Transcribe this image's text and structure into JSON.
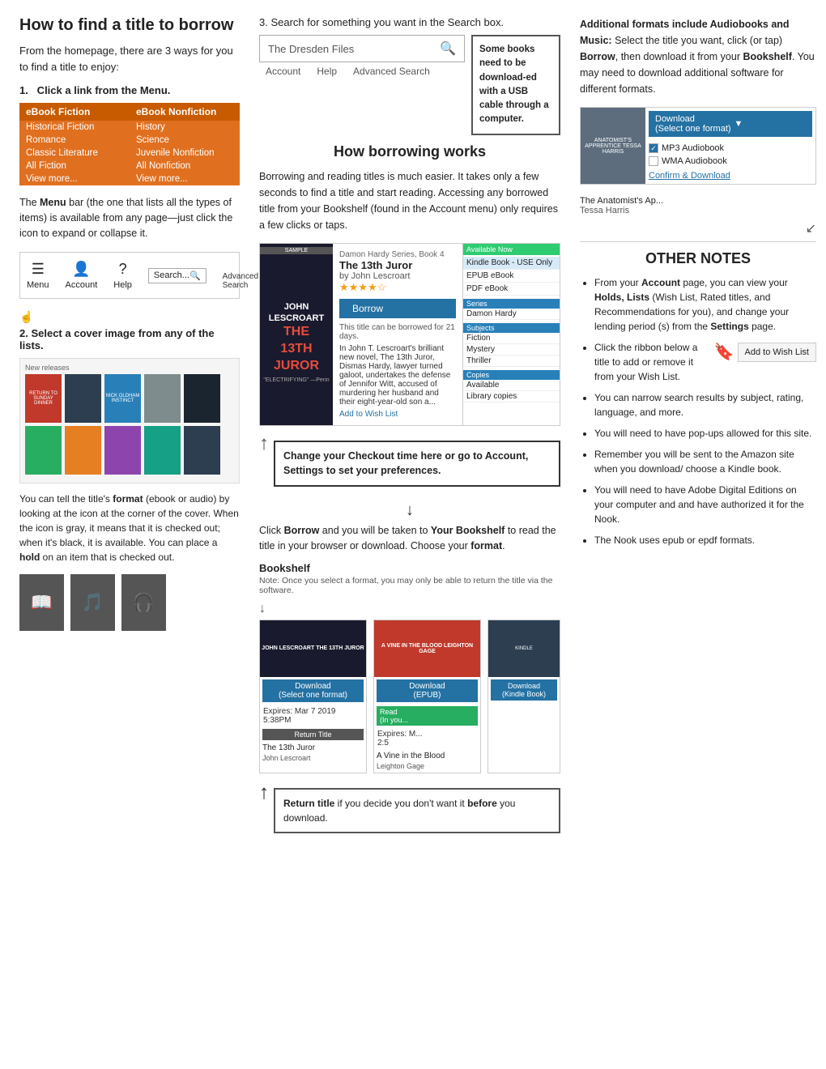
{
  "page": {
    "title": "How to find a title to borrow"
  },
  "left": {
    "title": "How to find a title to borrow",
    "intro": "From the homepage, there are 3 ways for you to find a title to enjoy:",
    "step1": {
      "label": "1.  Click a link from the ",
      "bold": "Menu.",
      "menu": {
        "col1_header": "eBook Fiction",
        "col1_items": [
          "Historical Fiction",
          "Romance",
          "Classic Literature",
          "All Fiction",
          "View more..."
        ],
        "col2_header": "eBook Nonfiction",
        "col2_items": [
          "History",
          "Science",
          "Juvenile Nonfiction",
          "All Nonfiction",
          "View more..."
        ]
      },
      "desc": "The Menu bar (the one that lists all the types of items) is available from any page—just click the icon to expand or collapse it.",
      "nav_items": [
        "Menu",
        "Account",
        "Help"
      ],
      "nav_search_placeholder": "Search..."
    },
    "step2": {
      "label": "2. Select a cover image from any of the lists.",
      "desc1": "You can tell the title's ",
      "bold1": "format",
      "desc2": " (ebook or audio) by looking at the icon at the corner of the cover. When the icon is gray, it means that it is checked out; when it's black, it is available. You can place a ",
      "bold2": "hold",
      "desc3": " on an item that is checked out."
    }
  },
  "middle": {
    "step3": "3.   Search for something you want in the Search box.",
    "search_value": "The Dresden Files",
    "search_links": [
      "Account",
      "Help",
      "Advanced Search"
    ],
    "how_borrow_title": "How borrowing works",
    "borrow_desc": "Borrowing and reading titles is much easier. It takes only a few seconds to find a title and start reading. Accessing any borrowed title from your Bookshelf (found in the Account menu) only requires a few clicks or taps.",
    "book_detail": {
      "series": "Damon Hardy Series, Book 4",
      "title": "The 13th Juror",
      "author": "by John Lescroart",
      "borrow_btn": "Borrow",
      "note": "This title can be borrowed for 21 days.",
      "sample_badge": "SAMPLE",
      "available_label": "Available Now",
      "formats": [
        "Kindle Book - USE Only",
        "EPUB eBook",
        "PDF eBook"
      ],
      "sidebar_sections": {
        "series_label": "Series",
        "series_val": "Damon Hardy",
        "subjects_label": "Subjects",
        "subjects": [
          "Fiction",
          "Mystery",
          "Thriller"
        ],
        "copies_label": "Copies",
        "copies": [
          "Available",
          "Library copies"
        ]
      }
    },
    "checkout_callout": "Change your Checkout time here or go to Account, Settings to set your preferences.",
    "click_borrow": {
      "text1": "Click ",
      "bold1": "Borrow",
      "text2": " and you will be taken to ",
      "bold2": "Your Bookshelf",
      "text3": " to read the title in your browser or download. Choose your ",
      "bold3": "format",
      "text4": "."
    },
    "bookshelf_title": "Bookshelf",
    "bookshelf_note": "Note: Once you select a format, you may only be able to return the title via the software.",
    "bs_card1": {
      "title": "The 13th Juror",
      "author": "John Lescroart",
      "download_btn": "Download\n(Select one format)",
      "expires": "Expires: Mar 7 2019\n5:38PM",
      "return_btn": "Return Title"
    },
    "bs_card2": {
      "title": "A Vine in the Blood",
      "author": "Leighton Gage",
      "download_btn": "Download\n(EPUB)",
      "expires": "Expires: M...\n2:5",
      "read_btn": "Read\n(In you..."
    },
    "bs_card3": {
      "download_btn": "Download\n(Kindle Book)"
    },
    "return_callout": {
      "bold1": "Return title",
      "text": " if you decide you don't want it ",
      "bold2": "before",
      "text2": " you download."
    }
  },
  "right": {
    "additional_title": "Additional formats include Audiobooks and Music:",
    "additional_desc": " Select the title you want, click (or tap) Borrow, then download it from your Bookshelf. You may need to download additional software for different formats.",
    "download_mock": {
      "book_title": "The Anatomist's Ap...",
      "book_author": "Tessa Harris",
      "download_btn": "Download\n(Select one format)",
      "options": [
        "MP3 Audiobook",
        "WMA Audiobook"
      ],
      "checked_option": "MP3 Audiobook",
      "confirm_link": "Confirm & Download"
    },
    "some_books_callout": "Some books need to be download-ed with a USB cable through a computer.",
    "other_notes_title": "OTHER NOTES",
    "notes": [
      {
        "text": "From your Account page, you can view your Holds, Lists (Wish List, Rated titles, and Recommendations for you), and change your lending period (s) from the Settings page.",
        "bolds": [
          "Account",
          "Holds, Lists",
          "Settings"
        ]
      },
      {
        "text": "Click the ribbon below a title to add or remove it from your Wish List.",
        "has_wish_list": true
      },
      {
        "text": "You can narrow search results by subject, rating, language, and more."
      },
      {
        "text": "You will need to have pop-ups allowed for this site."
      },
      {
        "text": "Remember you will be sent to the Amazon site when you download/ choose a Kindle book."
      },
      {
        "text": "You will need to have Adobe Digital Editions on your computer and and have authorized it for the Nook."
      },
      {
        "text": "The Nook uses epub or epdf formats."
      }
    ]
  }
}
